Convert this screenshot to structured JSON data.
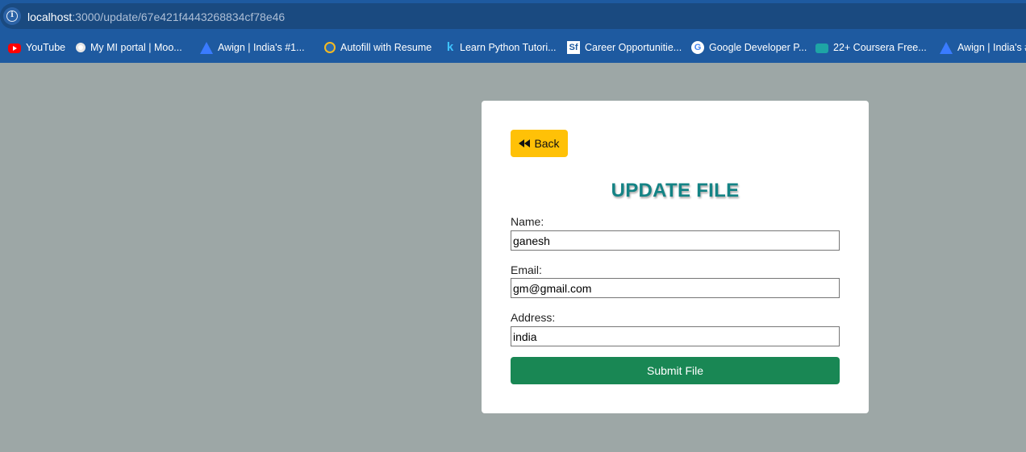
{
  "browser": {
    "url_host": "localhost",
    "url_rest": ":3000/update/67e421f4443268834cf78e46",
    "info_icon": "info-icon"
  },
  "bookmarks": [
    {
      "label": "YouTube",
      "icon": "youtube-icon"
    },
    {
      "label": "My MI portal | Moo...",
      "icon": "portal-icon"
    },
    {
      "label": "Awign | India's #1...",
      "icon": "awign-icon"
    },
    {
      "label": "Autofill with Resume",
      "icon": "autofill-icon"
    },
    {
      "label": "Learn Python Tutori...",
      "icon": "k-icon",
      "glyph": "k"
    },
    {
      "label": "Career Opportunitie...",
      "icon": "sf-icon",
      "glyph": "Sf"
    },
    {
      "label": "Google Developer P...",
      "icon": "google-icon",
      "glyph": "G"
    },
    {
      "label": "22+ Coursera Free...",
      "icon": "coursera-icon"
    },
    {
      "label": "Awign | India's #",
      "icon": "awign-icon"
    }
  ],
  "form": {
    "back_label": "Back",
    "back_icon": "rewind-icon",
    "title": "UPDATE FILE",
    "name_label": "Name:",
    "name_value": "ganesh",
    "email_label": "Email:",
    "email_value": "gm@gmail.com",
    "address_label": "Address:",
    "address_value": "india",
    "submit_label": "Submit File"
  },
  "colors": {
    "page_bg": "#9da7a6",
    "browser_blue": "#1e5aa0",
    "back_button": "#ffc107",
    "title": "#148385",
    "submit_button": "#198754"
  }
}
